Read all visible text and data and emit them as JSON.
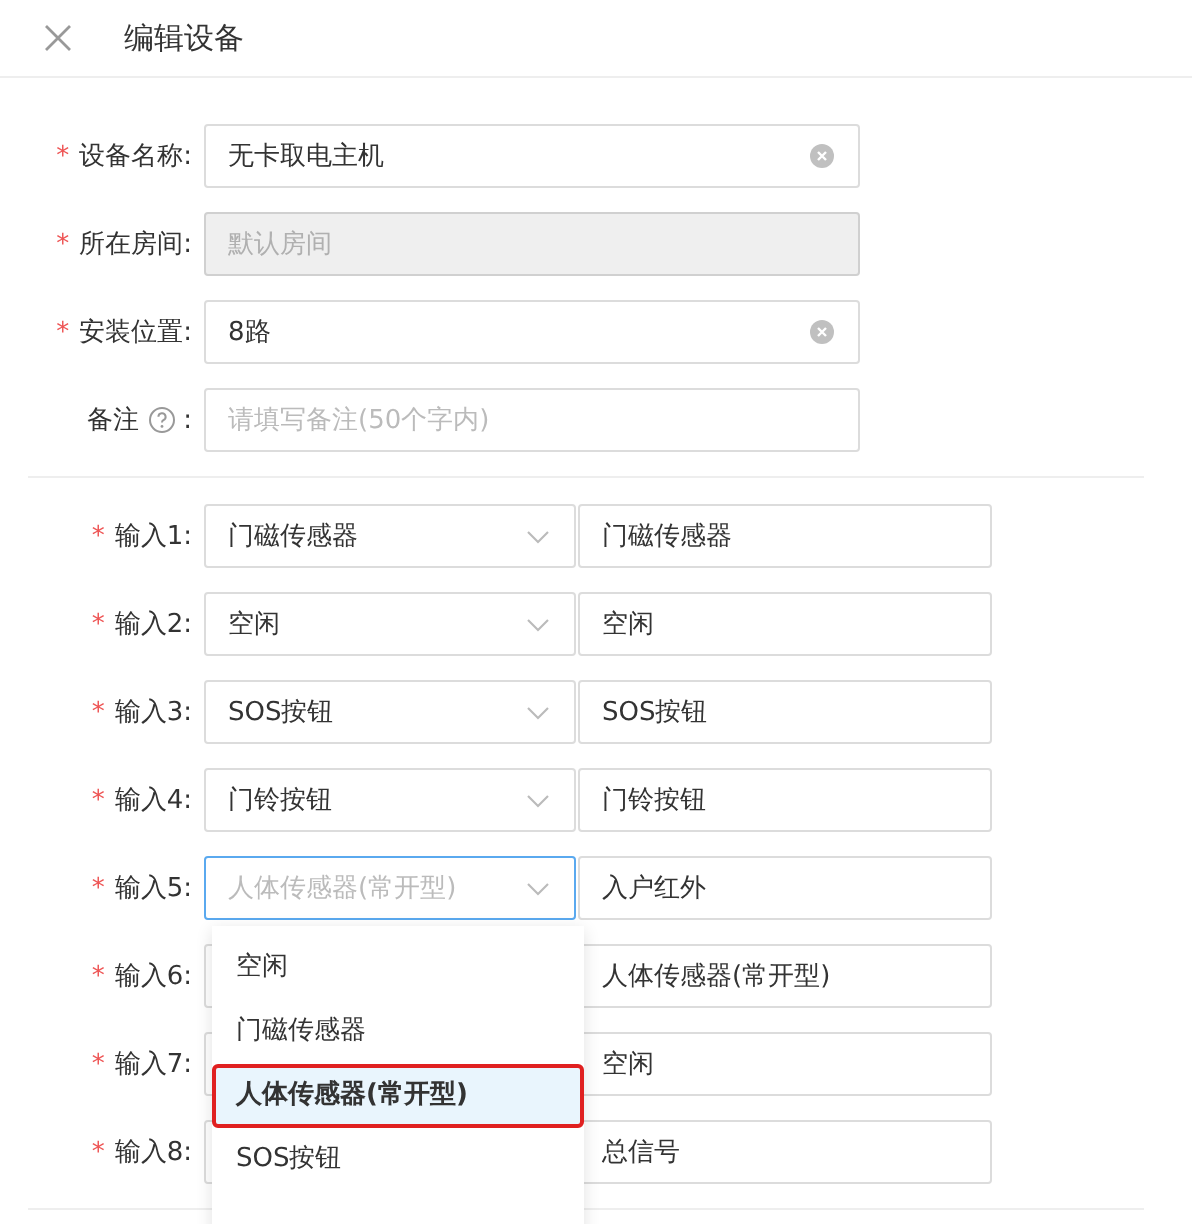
{
  "window": {
    "title": "编辑设备"
  },
  "required_mark": "*",
  "fields": [
    {
      "label": "设备名称:",
      "required": true,
      "value": "无卡取电主机",
      "clearable": true,
      "disabled": false
    },
    {
      "label": "所在房间:",
      "required": true,
      "placeholder": "默认房间",
      "clearable": false,
      "disabled": true
    },
    {
      "label": "安装位置:",
      "required": true,
      "value": "8路",
      "clearable": true,
      "disabled": false
    },
    {
      "label": "备注",
      "colon": ":",
      "help": true,
      "required": false,
      "placeholder": "请填写备注(50个字内)",
      "clearable": false,
      "disabled": false
    }
  ],
  "inputs": [
    {
      "label": "输入1:",
      "select": "门磁传感器",
      "name": "门磁传感器",
      "focused": false
    },
    {
      "label": "输入2:",
      "select": "空闲",
      "name": "空闲",
      "focused": false
    },
    {
      "label": "输入3:",
      "select": "SOS按钮",
      "name": "SOS按钮",
      "focused": false
    },
    {
      "label": "输入4:",
      "select": "门铃按钮",
      "name": "门铃按钮",
      "focused": false
    },
    {
      "label": "输入5:",
      "select_placeholder": "人体传感器(常开型)",
      "name": "入户红外",
      "focused": true
    },
    {
      "label": "输入6:",
      "name": "人体传感器(常开型)",
      "focused": false
    },
    {
      "label": "输入7:",
      "name": "空闲",
      "focused": false
    },
    {
      "label": "输入8:",
      "name": "总信号",
      "focused": false
    }
  ],
  "dropdown": {
    "options": [
      {
        "label": "空闲",
        "selected": false
      },
      {
        "label": "门磁传感器",
        "selected": false
      },
      {
        "label": "人体传感器(常开型)",
        "selected": true
      },
      {
        "label": "SOS按钮",
        "selected": false
      }
    ]
  }
}
